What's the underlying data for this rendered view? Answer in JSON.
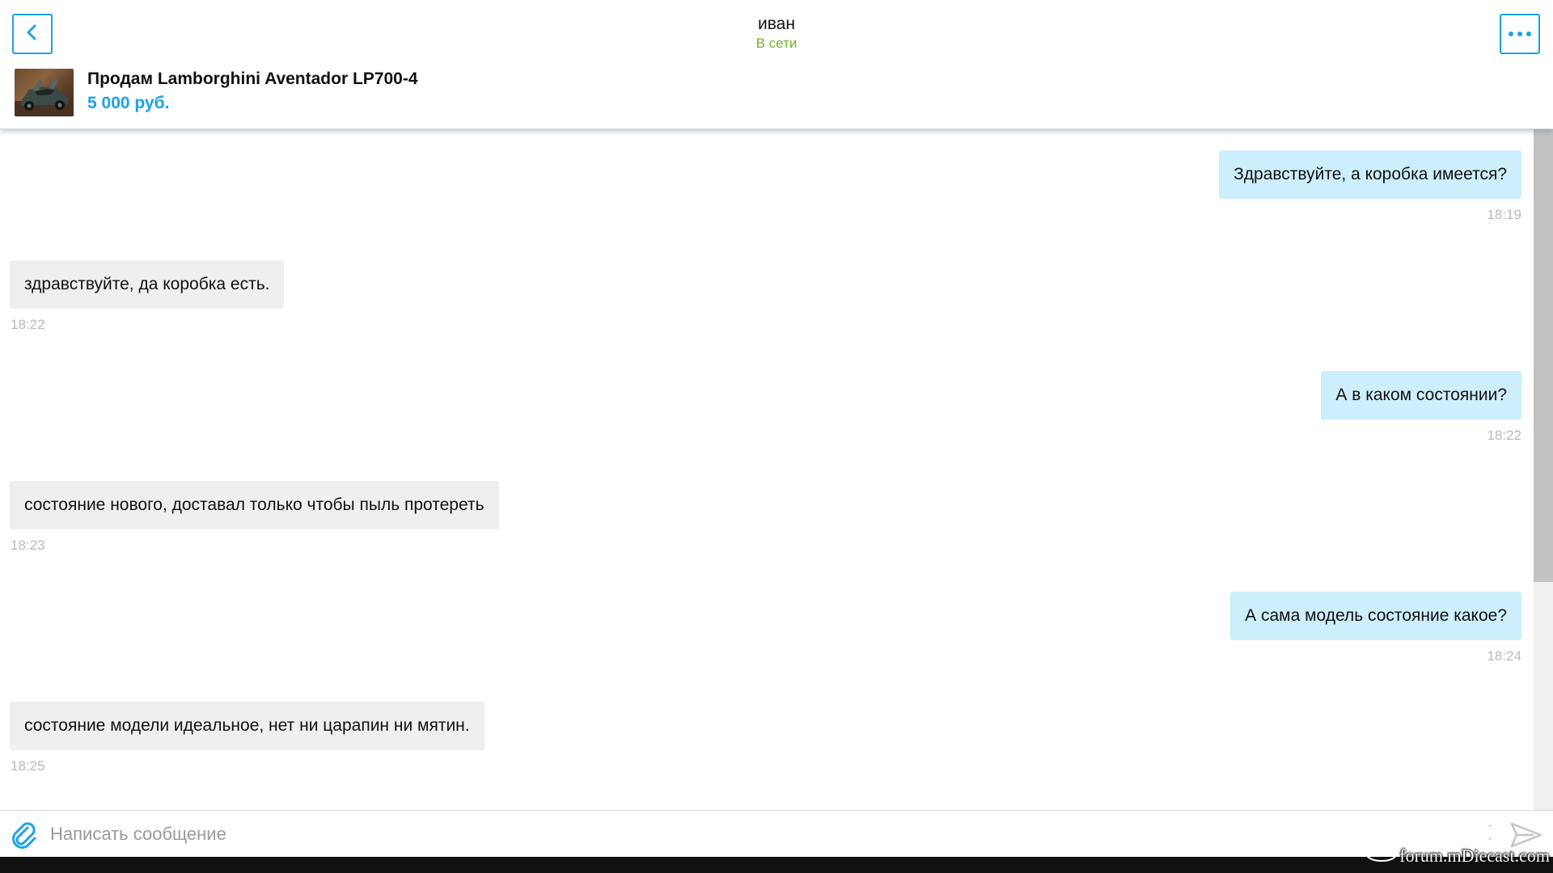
{
  "header": {
    "back_icon": "chevron-left-icon",
    "more_icon": "ellipsis-icon",
    "user_name": "иван",
    "user_status": "В сети",
    "listing": {
      "title": "Продам Lamborghini Aventador LP700-4",
      "price": "5 000 руб."
    }
  },
  "messages": [
    {
      "direction": "out",
      "text": "Здравствуйте, а коробка имеется?",
      "time": "18:19"
    },
    {
      "direction": "in",
      "text": "здравствуйте, да коробка есть.",
      "time": "18:22"
    },
    {
      "direction": "out",
      "text": "А в каком состоянии?",
      "time": "18:22"
    },
    {
      "direction": "in",
      "text": "состояние нового, доставал только чтобы пыль протереть",
      "time": "18:23"
    },
    {
      "direction": "out",
      "text": "А сама модель состояние какое?",
      "time": "18:24"
    },
    {
      "direction": "in",
      "text": "состояние модели идеальное, нет ни царапин ни мятин.",
      "time": "18:25"
    }
  ],
  "composer": {
    "placeholder": "Написать сообщение",
    "value": "",
    "attach_icon": "paperclip-icon",
    "send_icon": "send-icon"
  },
  "watermark": "forum.mDiecast.com",
  "colors": {
    "accent": "#1aa3e8",
    "online": "#75b12b",
    "outgoing_bubble": "#cdeefb",
    "incoming_bubble": "#efefef",
    "timestamp": "#b9b9b9"
  }
}
